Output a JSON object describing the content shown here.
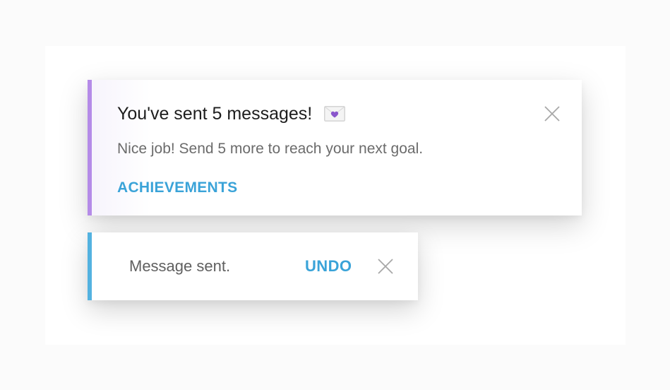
{
  "colors": {
    "achievement_accent": "#b58be8",
    "sent_accent": "#53b2e0",
    "link": "#3aa3d8",
    "close_icon": "#a8a8a8"
  },
  "achievement_toast": {
    "title": "You've sent 5 messages!",
    "title_icon": "envelope-heart-icon",
    "message": "Nice job! Send 5 more to reach your next goal.",
    "action_label": "ACHIEVEMENTS",
    "close_icon": "close-icon"
  },
  "sent_toast": {
    "message": "Message sent.",
    "action_label": "UNDO",
    "close_icon": "close-icon"
  }
}
